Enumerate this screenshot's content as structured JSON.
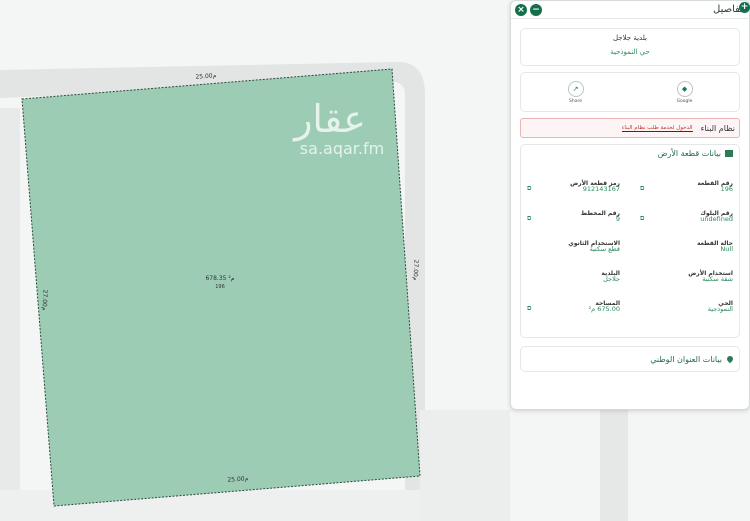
{
  "map": {
    "watermark_arabic": "عقار",
    "watermark_url": "sa.aqar.fm",
    "edge_top": "25.00م",
    "edge_bottom": "25.00م",
    "edge_left": "27.00م",
    "edge_right": "27.00م",
    "parcel_area": "678.35 م²",
    "parcel_number": "196"
  },
  "panel": {
    "title": "تفاصيل",
    "municipality": "بلدية جلاجل",
    "district": "حي النموذجية",
    "links": [
      {
        "label": "Google",
        "icon": "map-icon"
      },
      {
        "label": "Share",
        "icon": "share-icon"
      }
    ],
    "building_system_label": "نظام البناء",
    "building_system_link": "الدخول لخدمة طلب نظام البناء",
    "land_section_title": "بيانات قطعة الأرض",
    "fields": {
      "parcel_no_label": "رقم القطعة",
      "parcel_no_value": "196",
      "parcel_code_label": "رمز قطعة الأرض",
      "parcel_code_value": "912143167",
      "block_no_label": "رقم البلوك",
      "block_no_value": "undefined",
      "plan_no_label": "رقم المخطط",
      "plan_no_value": "9",
      "status_label": "حالة القطعة",
      "status_value": "Null",
      "secondary_use_label": "الاستخدام الثانوي",
      "secondary_use_value": "قطع سكنية",
      "land_use_label": "استخدام الأرض",
      "land_use_value": "شقة سكنية",
      "municipality_label": "البلدية",
      "municipality_value": "جلاجل",
      "district_label": "الحي",
      "district_value": "النموذجية",
      "area_label": "المساحة",
      "area_value": "675.00 م²"
    },
    "address_section_title": "بيانات العنوان الوطني"
  }
}
